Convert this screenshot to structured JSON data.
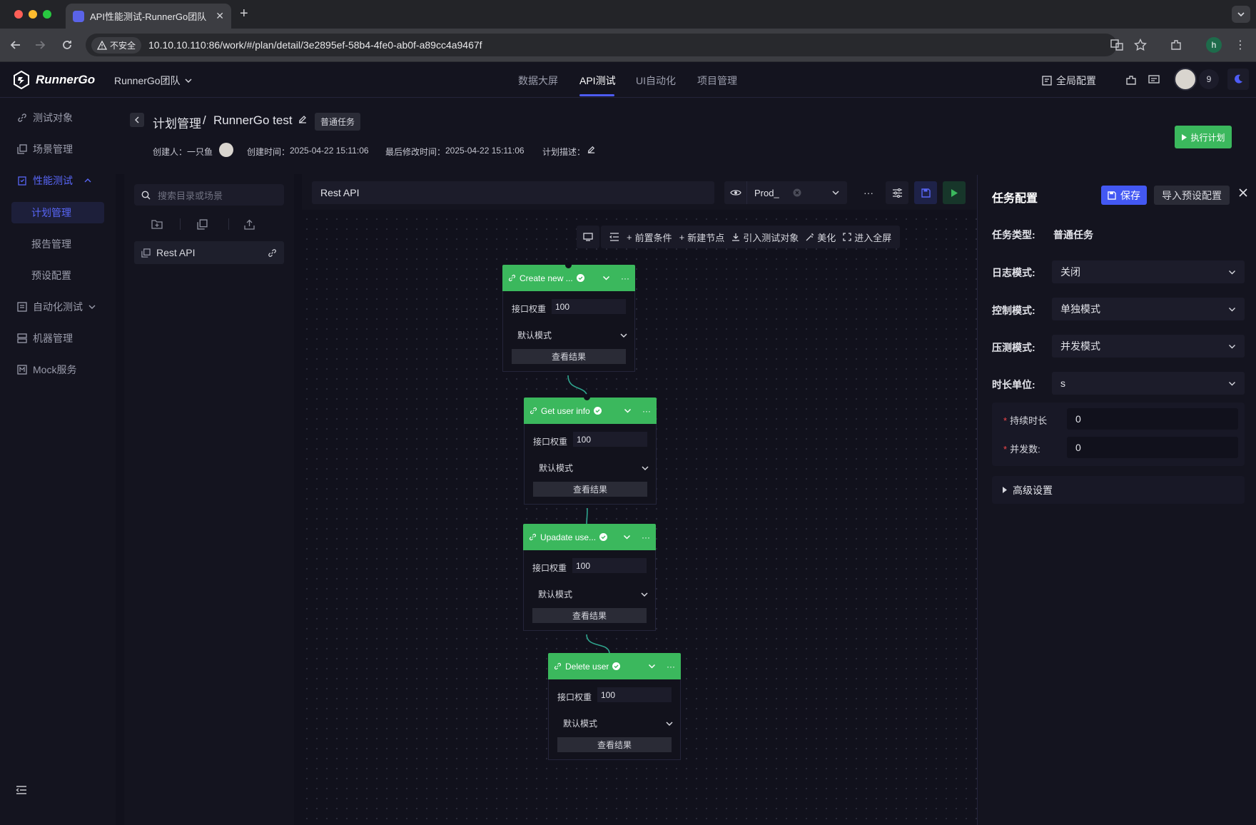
{
  "browser": {
    "tab_title": "API性能测试-RunnerGo团队",
    "insecure_label": "不安全",
    "url": "10.10.10.110:86/work/#/plan/detail/3e2895ef-58b4-4fe0-ab0f-a89cc4a9467f",
    "profile_initial": "h"
  },
  "header": {
    "brand": "RunnerGo",
    "team": "RunnerGo团队",
    "nav": [
      "数据大屏",
      "API测试",
      "UI自动化",
      "项目管理"
    ],
    "active_nav": "API测试",
    "global_config": "全局配置",
    "notification_count": "9"
  },
  "sidebar": {
    "items": [
      {
        "label": "测试对象",
        "icon": "link-icon"
      },
      {
        "label": "场景管理",
        "icon": "copy-icon"
      },
      {
        "label": "性能测试",
        "icon": "clipboard-icon"
      },
      {
        "label": "自动化测试",
        "icon": "list-icon"
      },
      {
        "label": "机器管理",
        "icon": "server-icon"
      },
      {
        "label": "Mock服务",
        "icon": "mock-icon"
      }
    ],
    "sub_items": [
      "计划管理",
      "报告管理",
      "预设配置"
    ],
    "active_sub": "计划管理"
  },
  "plan": {
    "crumb_root": "计划管理",
    "crumb_sep": "/",
    "plan_name": "RunnerGo test",
    "task_tag": "普通任务",
    "creator_label": "创建人：",
    "creator": "一只鱼",
    "created_label": "创建时间：",
    "created": "2025-04-22 15:11:06",
    "modified_label": "最后修改时间：",
    "modified": "2025-04-22 15:11:06",
    "desc_label": "计划描述：",
    "run_button": "执行计划"
  },
  "tree": {
    "search_placeholder": "搜索目录或场景",
    "scene": "Rest API"
  },
  "canvas": {
    "scene_name": "Rest API",
    "env": "Prod_",
    "toolbar": [
      "前置条件",
      "新建节点",
      "引入测试对象",
      "美化",
      "进入全屏"
    ],
    "nodes": [
      {
        "name": "Create new ...",
        "weight_label": "接口权重",
        "weight": "100",
        "mode": "默认模式",
        "result": "查看结果"
      },
      {
        "name": "Get user info",
        "weight_label": "接口权重",
        "weight": "100",
        "mode": "默认模式",
        "result": "查看结果"
      },
      {
        "name": "Upadate use...",
        "weight_label": "接口权重",
        "weight": "100",
        "mode": "默认模式",
        "result": "查看结果"
      },
      {
        "name": "Delete user",
        "weight_label": "接口权重",
        "weight": "100",
        "mode": "默认模式",
        "result": "查看结果"
      }
    ]
  },
  "config": {
    "title": "任务配置",
    "save": "保存",
    "import": "导入预设配置",
    "task_type_label": "任务类型:",
    "task_type": "普通任务",
    "log_mode_label": "日志模式:",
    "log_mode": "关闭",
    "control_mode_label": "控制模式:",
    "control_mode": "单独模式",
    "stress_mode_label": "压测模式:",
    "stress_mode": "并发模式",
    "duration_unit_label": "时长单位:",
    "duration_unit": "s",
    "duration_label": "持续时长",
    "duration": "0",
    "concurrency_label": "并发数:",
    "concurrency": "0",
    "advanced": "高级设置"
  },
  "colors": {
    "accent": "#4e5cf5",
    "node_green": "#3bb85d",
    "background": "#0f0f1b"
  }
}
